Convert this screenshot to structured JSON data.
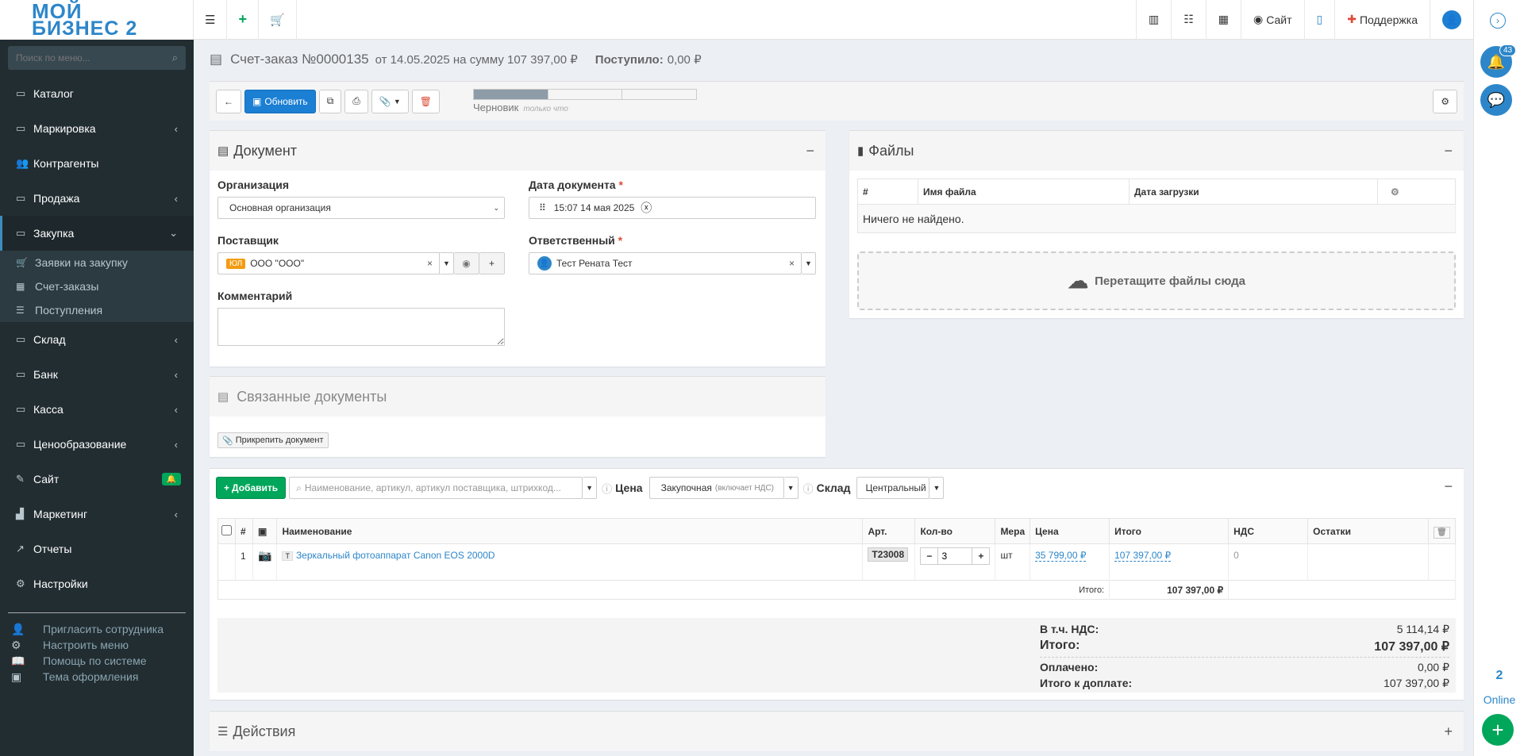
{
  "logo": {
    "line1": "МОЙ",
    "line2": "БИЗНЕС 2"
  },
  "sidebar": {
    "search_placeholder": "Поиск по меню...",
    "items": [
      {
        "label": "Каталог",
        "icon": "folder-icon"
      },
      {
        "label": "Маркировка",
        "icon": "folder-icon"
      },
      {
        "label": "Контрагенты",
        "icon": "users-icon"
      },
      {
        "label": "Продажа",
        "icon": "folder-icon"
      },
      {
        "label": "Закупка",
        "icon": "folder-icon"
      },
      {
        "label": "Склад",
        "icon": "folder-icon"
      },
      {
        "label": "Банк",
        "icon": "folder-icon"
      },
      {
        "label": "Касса",
        "icon": "folder-icon"
      },
      {
        "label": "Ценообразование",
        "icon": "folder-icon"
      },
      {
        "label": "Сайт",
        "icon": "magic-icon"
      },
      {
        "label": "Маркетинг",
        "icon": "chart-icon"
      },
      {
        "label": "Отчеты",
        "icon": "line-chart-icon"
      },
      {
        "label": "Настройки",
        "icon": "gear-icon"
      }
    ],
    "sub_items": [
      "Заявки на закупку",
      "Счет-заказы",
      "Поступления"
    ],
    "utils": [
      "Пригласить сотрудника",
      "Настроить меню",
      "Помощь по системе",
      "Тема оформления"
    ]
  },
  "topbar": {
    "site": "Сайт",
    "support": "Поддержка"
  },
  "rightbar": {
    "notif_count": "43",
    "online_count": "2",
    "online_label": "Online"
  },
  "page": {
    "title": "Счет-заказ №0000135",
    "subtitle": "от 14.05.2025  на сумму 107 397,00 ₽",
    "received_label": "Поступило:",
    "received_value": "0,00 ₽"
  },
  "toolbar": {
    "update_label": "Обновить",
    "status": "Черновик",
    "status_time": "только что",
    "progress_fraction": 0.333
  },
  "document": {
    "title": "Документ",
    "org_label": "Организация",
    "org_value": "Основная организация",
    "date_label": "Дата документа",
    "date_value": "15:07 14 мая 2025",
    "supplier_label": "Поставщик",
    "supplier_tag": "ЮЛ",
    "supplier_value": "ООО \"ООО\"",
    "responsible_label": "Ответственный",
    "responsible_value": "Тест Рената Тест",
    "comment_label": "Комментарий"
  },
  "related": {
    "title": "Связанные документы",
    "attach_label": "Прикрепить документ"
  },
  "files": {
    "title": "Файлы",
    "col_num": "#",
    "col_name": "Имя файла",
    "col_date": "Дата загрузки",
    "empty": "Ничего не найдено.",
    "drop": "Перетащите файлы сюда"
  },
  "goods": {
    "add_label": "Добавить",
    "search_placeholder": "Наименование, артикул, артикул поставщика, штрихкод...",
    "price_label": "Цена",
    "price_value": "Закупочная",
    "price_note": "(включает НДС)",
    "warehouse_label": "Склад",
    "warehouse_value": "Центральный",
    "columns": [
      "#",
      "Наименование",
      "Арт.",
      "Кол-во",
      "Мера",
      "Цена",
      "Итого",
      "НДС",
      "Остатки"
    ],
    "rows": [
      {
        "num": "1",
        "type": "Т",
        "name": "Зеркальный фотоаппарат Canon EOS 2000D",
        "art": "T23008",
        "qty": "3",
        "unit": "шт",
        "price": "35 799,00 ₽",
        "total": "107 397,00 ₽",
        "vat": "0"
      }
    ],
    "footer_label": "Итого:",
    "footer_total": "107 397,00 ₽"
  },
  "summary": {
    "vat_label": "В т.ч. НДС:",
    "vat_value": "5 114,14 ₽",
    "total_label": "Итого:",
    "total_value": "107 397,00 ₽",
    "paid_label": "Оплачено:",
    "paid_value": "0,00 ₽",
    "due_label": "Итого к доплате:",
    "due_value": "107 397,00 ₽"
  },
  "actions": {
    "title": "Действия"
  },
  "colors": {
    "accent": "#2d86c9",
    "sidebar": "#222d32",
    "green": "#00a65a",
    "danger": "#dd4b39"
  }
}
